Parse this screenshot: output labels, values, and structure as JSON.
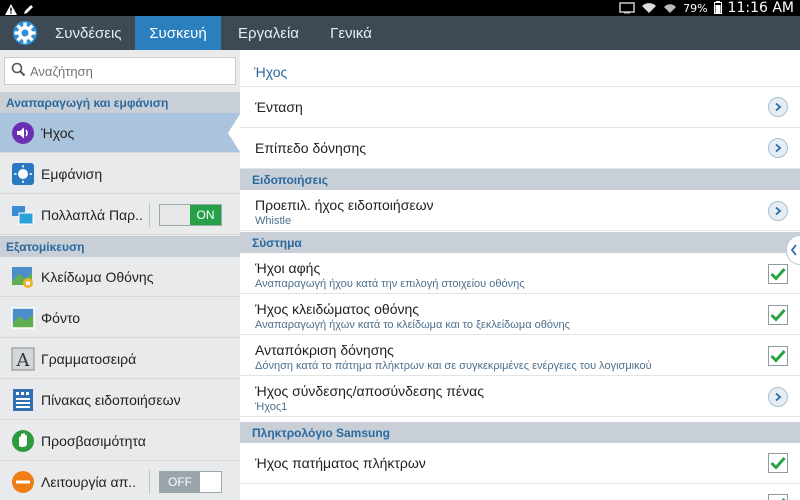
{
  "statusbar": {
    "battery": "79%",
    "time": "11:16 AM"
  },
  "tabs": [
    {
      "label": "Συνδέσεις"
    },
    {
      "label": "Συσκευή"
    },
    {
      "label": "Εργαλεία"
    },
    {
      "label": "Γενικά"
    }
  ],
  "search": {
    "placeholder": "Αναζήτηση"
  },
  "sidebar": {
    "section1": "Αναπαραγωγή και εμφάνιση",
    "section2": "Εξατομίκευση",
    "items": [
      {
        "label": "Ήχος"
      },
      {
        "label": "Εμφάνιση"
      },
      {
        "label": "Πολλαπλά Παρ..",
        "toggle": "ON"
      },
      {
        "label": "Κλείδωμα Οθόνης"
      },
      {
        "label": "Φόντο"
      },
      {
        "label": "Γραμματοσειρά"
      },
      {
        "label": "Πίνακας ειδοποιήσεων"
      },
      {
        "label": "Προσβασιμότητα"
      },
      {
        "label": "Λειτουργία απ..",
        "toggle": "OFF"
      }
    ]
  },
  "main": {
    "title": "Ήχος",
    "rows": [
      {
        "label": "Ένταση"
      },
      {
        "label": "Επίπεδο δόνησης"
      }
    ],
    "section_notifications": "Ειδοποιήσεις",
    "notif_row": {
      "label": "Προεπιλ. ήχος ειδοποιήσεων",
      "sub": "Whistle"
    },
    "section_system": "Σύστημα",
    "system_rows": [
      {
        "label": "Ήχοι αφής",
        "sub": "Αναπαραγωγή ήχου κατά την επιλογή στοιχείου οθόνης"
      },
      {
        "label": "Ήχος κλειδώματος οθόνης",
        "sub": "Αναπαραγωγή ήχων κατά το κλείδωμα και το ξεκλείδωμα οθόνης"
      },
      {
        "label": "Ανταπόκριση δόνησης",
        "sub": "Δόνηση κατά το πάτημα πλήκτρων και σε συγκεκριμένες ενέργειες του λογισμικού"
      },
      {
        "label": "Ήχος σύνδεσης/αποσύνδεσης πένας",
        "sub": "Ήχος1"
      }
    ],
    "section_keyboard": "Πληκτρολόγιο Samsung",
    "keyboard_rows": [
      {
        "label": "Ήχος πατήματος πλήκτρων"
      }
    ]
  },
  "colors": {
    "accent": "#2c7fbf",
    "header_bar": "#3d4a56",
    "section_bg": "#c8cfd6",
    "section_text": "#2a6a9e",
    "check_green": "#2aa345"
  }
}
